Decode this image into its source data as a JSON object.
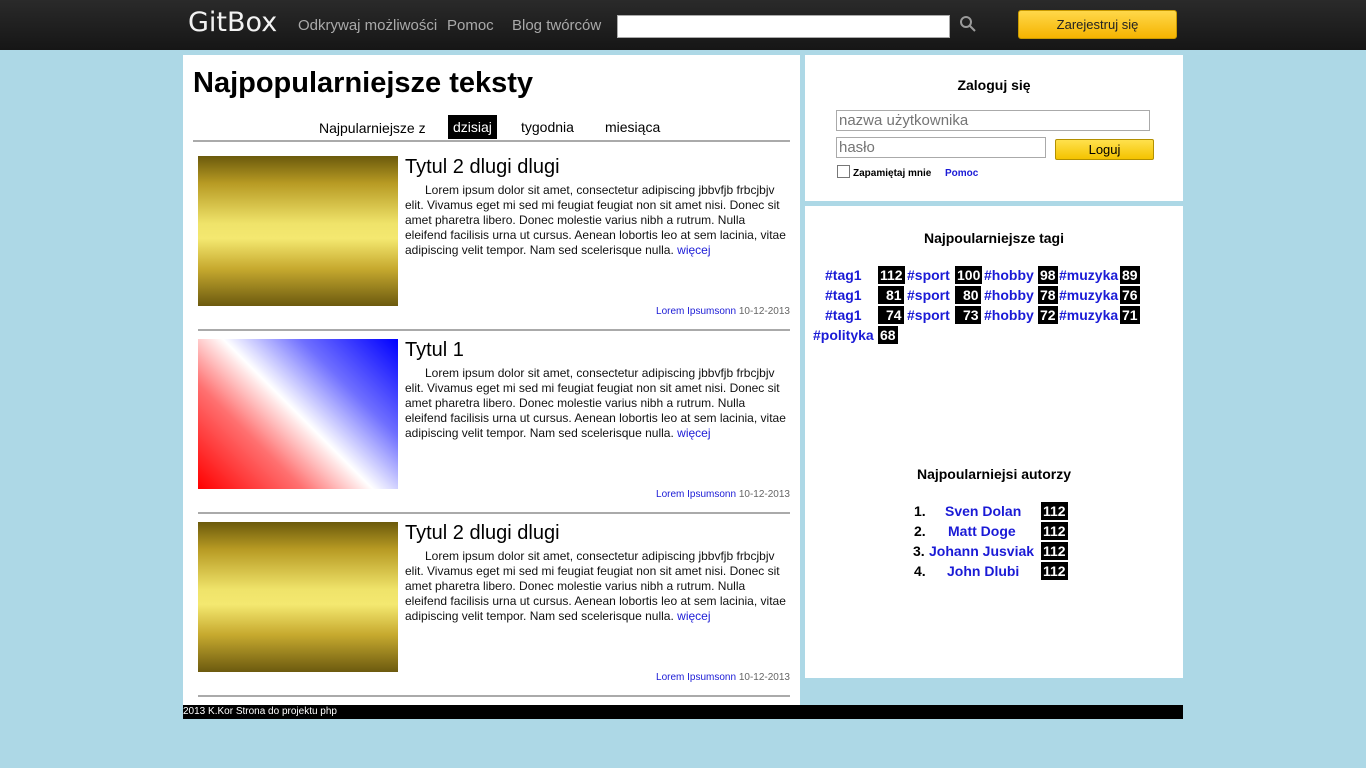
{
  "header": {
    "logo": "GitBox",
    "nav": [
      "Odkrywaj możliwości",
      "Pomoc",
      "Blog twórców"
    ],
    "search_value": "",
    "register_label": "Zarejestruj się"
  },
  "main": {
    "title": "Najpopularniejsze teksty",
    "filter_label": "Najpularniejsze z",
    "filter_tabs": [
      "dzisiaj",
      "tygodnia",
      "miesiąca"
    ],
    "selected_tab": "dzisiaj",
    "articles": [
      {
        "title": "Tytul 2 dlugi dlugi",
        "body": "Lorem ipsum dolor sit amet, consectetur adipiscing jbbvfjb frbcjbjv elit. Vivamus eget mi sed mi feugiat feugiat non sit amet nisi. Donec sit amet pharetra libero. Donec molestie varius nibh a rutrum. Nulla eleifend facilisis urna ut cursus. Aenean lobortis leo at sem lacinia, vitae adipiscing velit tempor. Nam sed scelerisque nulla.",
        "more": "więcej",
        "author": "Lorem Ipsumsonn",
        "date": "10-12-2013"
      },
      {
        "title": "Tytul 1",
        "body": "Lorem ipsum dolor sit amet, consectetur adipiscing jbbvfjb frbcjbjv elit. Vivamus eget mi sed mi feugiat feugiat non sit amet nisi. Donec sit amet pharetra libero. Donec molestie varius nibh a rutrum. Nulla eleifend facilisis urna ut cursus. Aenean lobortis leo at sem lacinia, vitae adipiscing velit tempor. Nam sed scelerisque nulla.",
        "more": "więcej",
        "author": "Lorem Ipsumsonn",
        "date": "10-12-2013"
      },
      {
        "title": "Tytul 2 dlugi dlugi",
        "body": "Lorem ipsum dolor sit amet, consectetur adipiscing jbbvfjb frbcjbjv elit. Vivamus eget mi sed mi feugiat feugiat non sit amet nisi. Donec sit amet pharetra libero. Donec molestie varius nibh a rutrum. Nulla eleifend facilisis urna ut cursus. Aenean lobortis leo at sem lacinia, vitae adipiscing velit tempor. Nam sed scelerisque nulla.",
        "more": "więcej",
        "author": "Lorem Ipsumsonn",
        "date": "10-12-2013"
      }
    ]
  },
  "login": {
    "title": "Zaloguj się",
    "username_placeholder": "nazwa użytkownika",
    "password_placeholder": "hasło",
    "submit_label": "Loguj",
    "remember_label": "Zapamiętaj mnie",
    "help_label": "Pomoc"
  },
  "tags": {
    "title": "Najpoularniejsze tagi",
    "items": [
      {
        "tag": "#tag1",
        "count": "112"
      },
      {
        "tag": "#sport",
        "count": "100"
      },
      {
        "tag": "#hobby",
        "count": "98"
      },
      {
        "tag": "#muzyka",
        "count": "89"
      },
      {
        "tag": "#tag1",
        "count": "81"
      },
      {
        "tag": "#sport",
        "count": "80"
      },
      {
        "tag": "#hobby",
        "count": "78"
      },
      {
        "tag": "#muzyka",
        "count": "76"
      },
      {
        "tag": "#tag1",
        "count": "74"
      },
      {
        "tag": "#sport",
        "count": "73"
      },
      {
        "tag": "#hobby",
        "count": "72"
      },
      {
        "tag": "#muzyka",
        "count": "71"
      },
      {
        "tag": "#polityka",
        "count": "68"
      }
    ]
  },
  "authors": {
    "title": "Najpoularniejsi autorzy",
    "items": [
      {
        "rank": "1.",
        "name": "Sven Dolan",
        "count": "112"
      },
      {
        "rank": "2.",
        "name": "Matt Doge",
        "count": "112"
      },
      {
        "rank": "3.",
        "name": "Johann Jusviak",
        "count": "112"
      },
      {
        "rank": "4.",
        "name": "John Dlubi",
        "count": "112"
      }
    ]
  },
  "footer": {
    "text": "2013 K.Kor Strona do projektu php"
  },
  "colors": {
    "background": "#add8e6",
    "link": "#1a1ad6",
    "accent": "#f5b400"
  }
}
